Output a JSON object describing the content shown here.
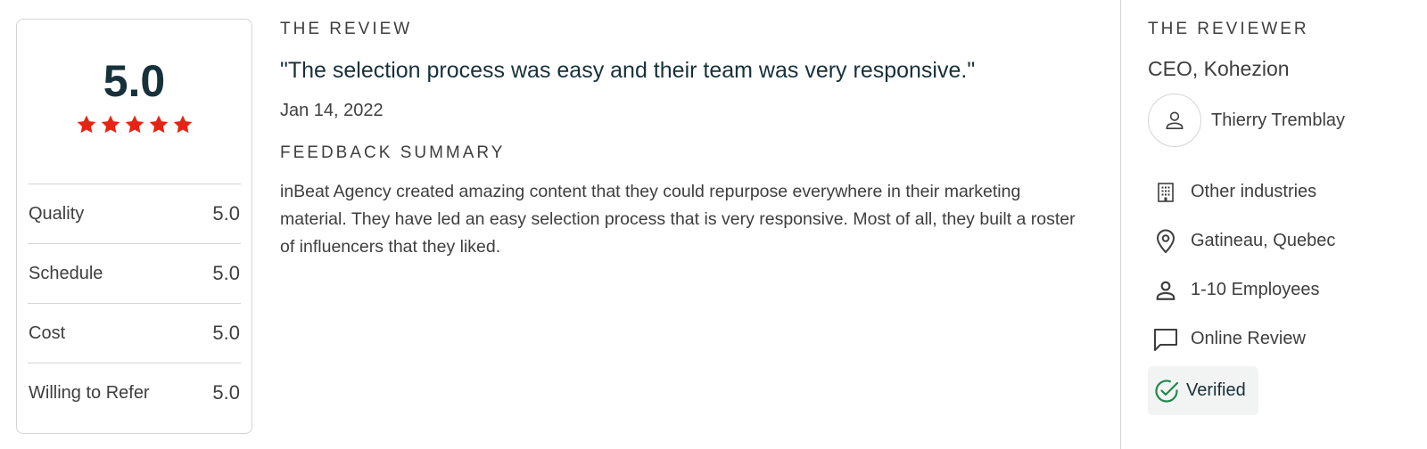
{
  "score": {
    "overall": "5.0",
    "stars_filled": 5,
    "stars_total": 5,
    "star_color": "#e62415",
    "metrics": [
      {
        "label": "Quality",
        "value": "5.0"
      },
      {
        "label": "Schedule",
        "value": "5.0"
      },
      {
        "label": "Cost",
        "value": "5.0"
      },
      {
        "label": "Willing to Refer",
        "value": "5.0"
      }
    ]
  },
  "review": {
    "heading": "THE REVIEW",
    "quote": "\"The selection process was easy and their team was very responsive.\"",
    "date": "Jan 14, 2022",
    "feedback_heading": "FEEDBACK SUMMARY",
    "summary": "inBeat Agency created amazing content that they could repurpose everywhere in their marketing material. They have led an easy selection process that is very responsive. Most of all, they built a roster of influencers that they liked."
  },
  "reviewer": {
    "heading": "THE REVIEWER",
    "role": "CEO, Kohezion",
    "name": "Thierry Tremblay",
    "avatar_icon": "user-icon",
    "facts": [
      {
        "icon": "building-icon",
        "label": "Other industries"
      },
      {
        "icon": "location-pin-icon",
        "label": "Gatineau, Quebec"
      },
      {
        "icon": "person-icon",
        "label": "1-10 Employees"
      },
      {
        "icon": "chat-bubble-icon",
        "label": "Online Review"
      }
    ],
    "verified_label": "Verified",
    "verified_color": "#1f8a4c"
  }
}
